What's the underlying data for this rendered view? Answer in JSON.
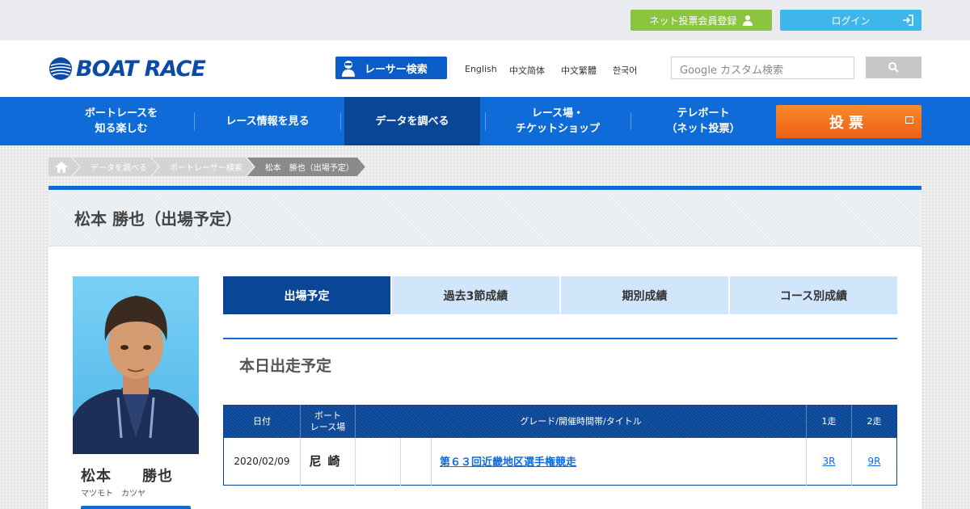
{
  "topbar": {
    "register_label": "ネット投票会員登録",
    "login_label": "ログイン"
  },
  "header": {
    "logo_text": "BOAT RACE",
    "racer_search_label": "レーサー検索",
    "languages": [
      "English",
      "中文简体",
      "中文繁體",
      "한국어"
    ],
    "search_placeholder": "Google カスタム検索"
  },
  "nav": {
    "items": [
      {
        "label": "ボートレースを\n知る楽しむ"
      },
      {
        "label": "レース情報を見る"
      },
      {
        "label": "データを調べる"
      },
      {
        "label": "レース場・\nチケットショップ"
      },
      {
        "label": "テレボート\n（ネット投票）"
      }
    ],
    "vote_label": "投票"
  },
  "breadcrumb": [
    "データを調べる",
    "ボートレーサー検索",
    "松本　勝也（出場予定）"
  ],
  "panel": {
    "title": "松本 勝也（出場予定）"
  },
  "profile": {
    "name_kanji": "松本　　勝也",
    "name_kana": "マツモト　カツヤ"
  },
  "tabs": [
    {
      "label": "出場予定",
      "active": true
    },
    {
      "label": "過去3節成績",
      "active": false
    },
    {
      "label": "期別成績",
      "active": false
    },
    {
      "label": "コース別成績",
      "active": false
    }
  ],
  "section_title": "本日出走予定",
  "table": {
    "headers": {
      "date": "日付",
      "venue": "ボート\nレース場",
      "grade": "グレード/開催時間帯/タイトル",
      "race1": "1走",
      "race2": "2走"
    },
    "rows": [
      {
        "date": "2020/02/09",
        "venue": "尼崎",
        "title": "第６３回近畿地区選手権競走",
        "race1": "3R",
        "race2": "9R"
      }
    ]
  },
  "colors": {
    "brand_blue": "#0e6bd8",
    "active_navy": "#0a4696",
    "register_green": "#8bc53f",
    "login_cyan": "#3fb6ea",
    "vote_orange": "#f27321"
  }
}
